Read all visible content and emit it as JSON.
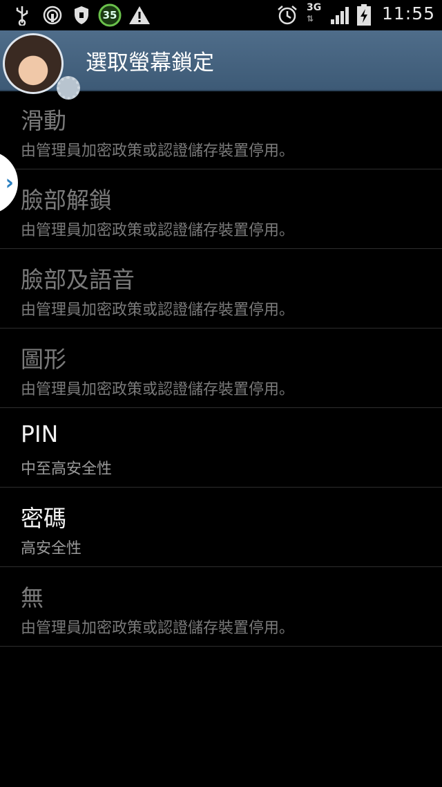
{
  "status_bar": {
    "icons": [
      "usb-icon",
      "hotspot-icon",
      "shield-icon",
      "battery-temp-icon",
      "warning-icon",
      "alarm-icon",
      "3g-icon",
      "signal-icon",
      "battery-icon"
    ],
    "temp_badge": "35",
    "network": "3G",
    "time": "11:55"
  },
  "action_bar": {
    "title": "選取螢幕鎖定"
  },
  "items": [
    {
      "title": "滑動",
      "subtitle": "由管理員加密政策或認證儲存裝置停用。",
      "enabled": false
    },
    {
      "title": "臉部解鎖",
      "subtitle": "由管理員加密政策或認證儲存裝置停用。",
      "enabled": false
    },
    {
      "title": "臉部及語音",
      "subtitle": "由管理員加密政策或認證儲存裝置停用。",
      "enabled": false
    },
    {
      "title": "圖形",
      "subtitle": "由管理員加密政策或認證儲存裝置停用。",
      "enabled": false
    },
    {
      "title": "PIN",
      "subtitle": "中至高安全性",
      "enabled": true
    },
    {
      "title": "密碼",
      "subtitle": "高安全性",
      "enabled": true
    },
    {
      "title": "無",
      "subtitle": "由管理員加密政策或認證儲存裝置停用。",
      "enabled": false
    }
  ],
  "handle_glyph": "›"
}
